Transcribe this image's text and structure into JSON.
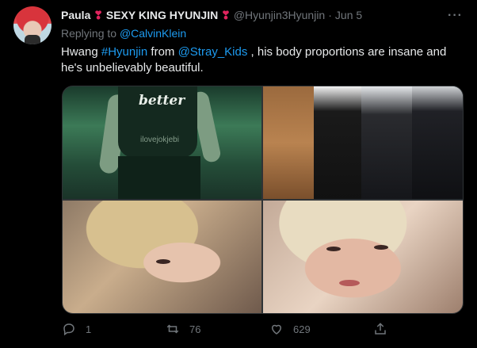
{
  "tweet": {
    "display_name": "Paula",
    "badge_text": "SEXY KING HYUNJIN",
    "heart_emoji": "❣",
    "handle": "@Hyunjin3Hyunjin",
    "separator": "·",
    "date": "Jun 5",
    "more_label": "···",
    "replying_prefix": "Replying to",
    "replying_to": "@CalvinKlein",
    "body": {
      "t1": "Hwang ",
      "hashtag": "#Hyunjin",
      "t2": " from ",
      "mention": "@Stray_Kids",
      "t3": " , his body proportions are insane and he's unbelievably beautiful."
    },
    "media": {
      "tile1_logo": "better",
      "tile1_watermark": "ilovejokjebi"
    },
    "actions": {
      "reply_count": "1",
      "retweet_count": "76",
      "like_count": "629"
    }
  },
  "colors": {
    "background": "#000000",
    "text": "#e7e9ea",
    "muted": "#71767b",
    "link": "#1d9bf0",
    "heart": "#e0245e"
  }
}
